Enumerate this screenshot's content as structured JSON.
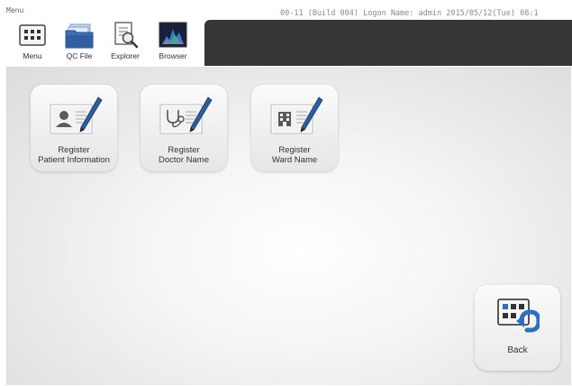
{
  "window": {
    "title": "Menu",
    "status": "00-11 (Build 004)  Logon Name: admin  2015/05/12(Tue) 08:1"
  },
  "toolbar": [
    {
      "label": "Menu",
      "icon": "menu-grid-icon"
    },
    {
      "label": "QC File",
      "icon": "folder-icon"
    },
    {
      "label": "Explorer",
      "icon": "document-search-icon"
    },
    {
      "label": "Browser",
      "icon": "chart-browser-icon"
    }
  ],
  "tiles": [
    {
      "line1": "Register",
      "line2": "Patient Information",
      "icon": "patient-card-icon"
    },
    {
      "line1": "Register",
      "line2": "Doctor Name",
      "icon": "doctor-card-icon"
    },
    {
      "line1": "Register",
      "line2": "Ward Name",
      "icon": "ward-card-icon"
    }
  ],
  "back": {
    "label": "Back",
    "icon": "back-arrow-icon"
  },
  "colors": {
    "header_dark": "#363636",
    "accent_blue": "#2f6fc0",
    "pen_blue": "#2d5e9c",
    "content_bg": "#e6e6e6"
  }
}
